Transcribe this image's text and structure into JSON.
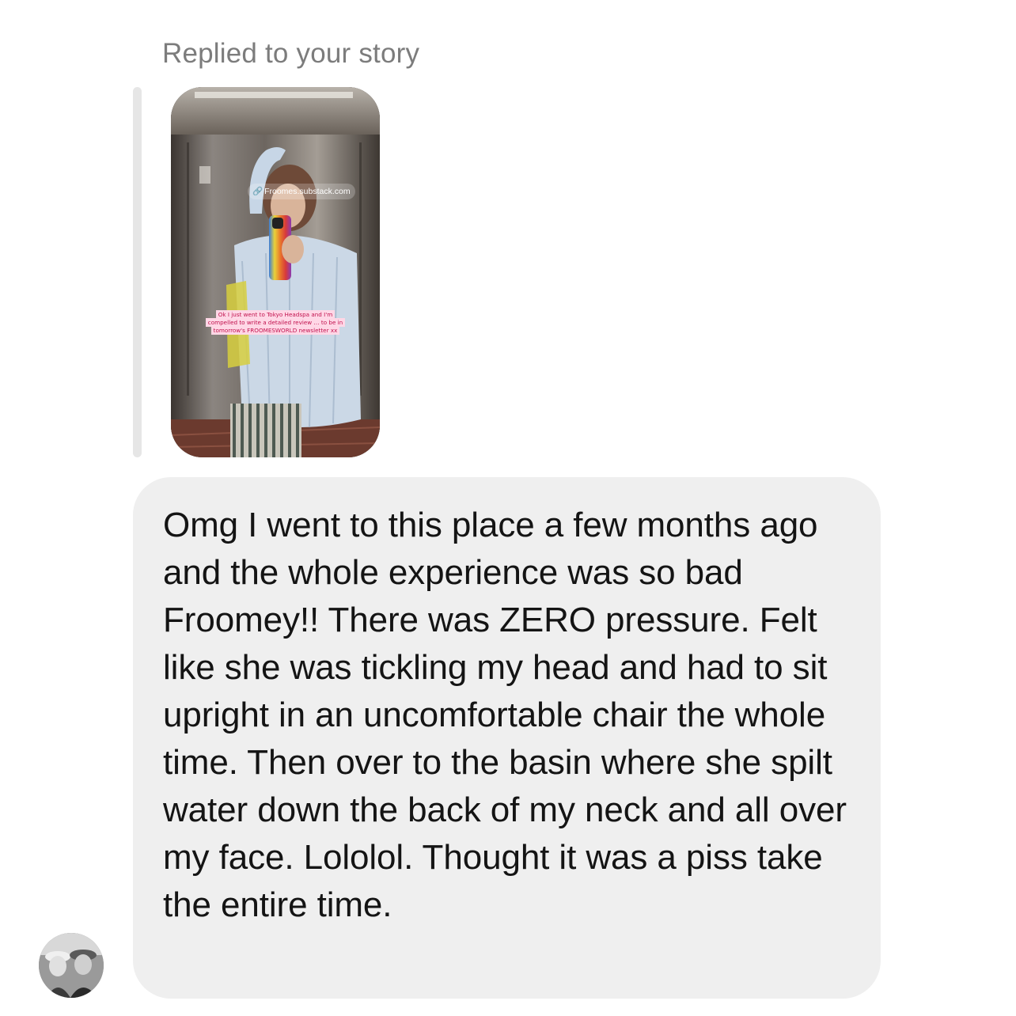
{
  "reply_header": {
    "label": "Replied to your story"
  },
  "story": {
    "link_sticker": "Froomes.substack.com",
    "caption": "Ok I just went to Tokyo Headspa and I'm compelled to write a detailed review … to be in tomorrow's FROOMESWORLD newsletter xx",
    "caption_color": "#c0124e",
    "caption_background": "#ffd7e6"
  },
  "message": {
    "text": "Omg I went to this place a few months ago and the whole experience was so bad Froomey!! There was ZERO pressure. Felt like she was tickling my head and had to sit upright in an uncomfortable chair the whole time. Then over to the basin where she spilt water down the back of my neck and all over my face. Lololol. Thought it was a piss take the entire time.",
    "bubble_color": "#efefef",
    "text_color": "#141414"
  },
  "sender": {
    "avatar_icon": "profile-photo-avatar"
  },
  "colors": {
    "background": "#ffffff",
    "secondary_text": "#7c7c7c",
    "quote_bar": "#e6e6e6"
  }
}
